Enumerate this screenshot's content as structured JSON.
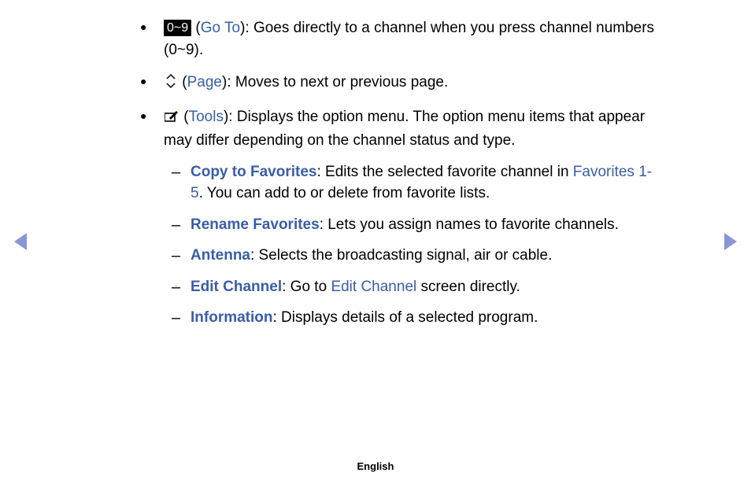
{
  "items": [
    {
      "badge": "0~9",
      "label": "Go To",
      "text": ": Goes directly to a channel when you press channel numbers (0~9)."
    },
    {
      "label": "Page",
      "text": ": Moves to next or previous page."
    },
    {
      "label": "Tools",
      "text": ": Displays the option menu. The option menu items that appear may differ depending on the channel status and type."
    }
  ],
  "sub": [
    {
      "label": "Copy to Favorites",
      "pre": ": Edits the selected favorite channel in ",
      "label2": "Favorites 1-5",
      "post": ". You can add to or delete from favorite lists."
    },
    {
      "label": "Rename Favorites",
      "text": ": Lets you assign names to favorite channels."
    },
    {
      "label": "Antenna",
      "text": ": Selects the broadcasting signal, air or cable."
    },
    {
      "label": "Edit Channel",
      "pre": ": Go to ",
      "label2": "Edit Channel",
      "post": " screen directly."
    },
    {
      "label": "Information",
      "text": ": Displays details of a selected program."
    }
  ],
  "footer": "English"
}
